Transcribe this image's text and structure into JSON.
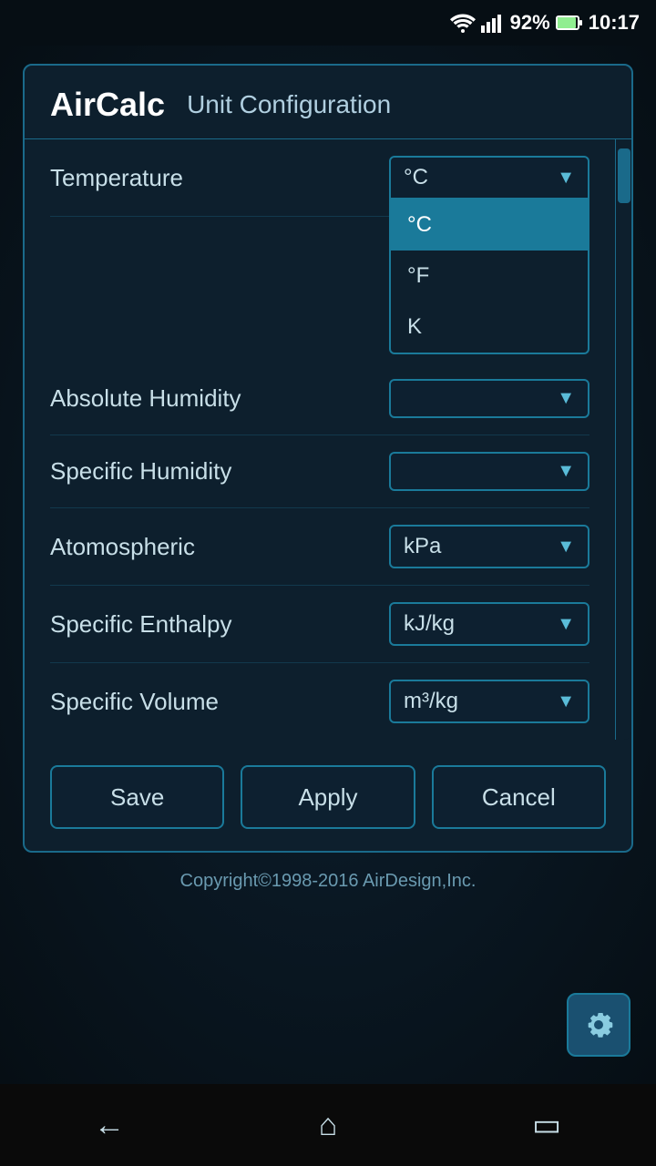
{
  "statusBar": {
    "wifi": "wifi-icon",
    "signal": "signal-icon",
    "battery": "92%",
    "time": "10:17"
  },
  "app": {
    "title": "AirCalc",
    "pageTitle": "Unit Configuration"
  },
  "form": {
    "rows": [
      {
        "label": "Temperature",
        "value": "°C",
        "open": true
      },
      {
        "label": "Absolute Humidity",
        "value": "",
        "open": false
      },
      {
        "label": "Specific Humidity",
        "value": "",
        "open": false
      },
      {
        "label": "Atomospheric",
        "value": "kPa",
        "open": false
      },
      {
        "label": "Specific Enthalpy",
        "value": "kJ/kg",
        "open": false
      },
      {
        "label": "Specific Volume",
        "value": "m³/kg",
        "open": false
      }
    ],
    "temperatureOptions": [
      {
        "value": "°C",
        "selected": true
      },
      {
        "value": "°F",
        "selected": false
      },
      {
        "value": "K",
        "selected": false
      }
    ]
  },
  "buttons": {
    "save": "Save",
    "apply": "Apply",
    "cancel": "Cancel"
  },
  "copyright": "Copyright©1998-2016 AirDesign,Inc.",
  "nav": {
    "back": "←",
    "home": "⌂",
    "recents": "▭"
  }
}
